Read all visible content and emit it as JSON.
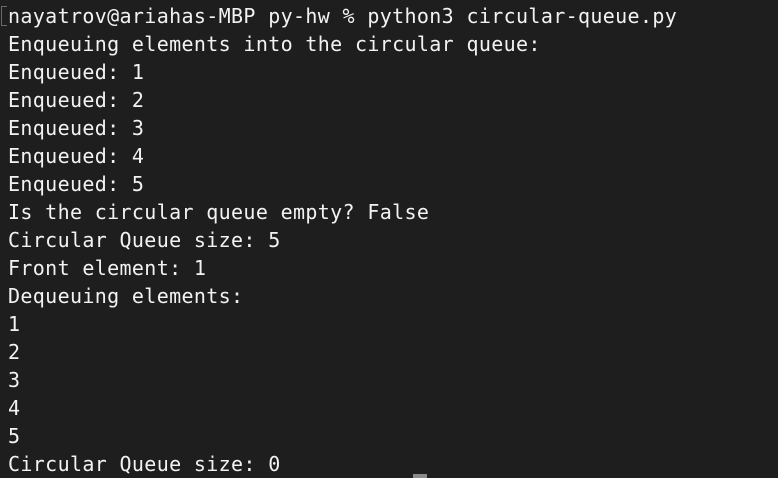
{
  "terminal": {
    "lines": [
      "nayatrov@ariahas-MBP py-hw % python3 circular-queue.py",
      "Enqueuing elements into the circular queue:",
      "Enqueued: 1",
      "Enqueued: 2",
      "Enqueued: 3",
      "Enqueued: 4",
      "Enqueued: 5",
      "Is the circular queue empty? False",
      "Circular Queue size: 5",
      "Front element: 1",
      "Dequeuing elements:",
      "1",
      "2",
      "3",
      "4",
      "5",
      "Circular Queue size: 0"
    ]
  },
  "colors": {
    "background": "#1e1e1e",
    "text": "#f2f2f2",
    "cursor": "#8a8a8a"
  }
}
